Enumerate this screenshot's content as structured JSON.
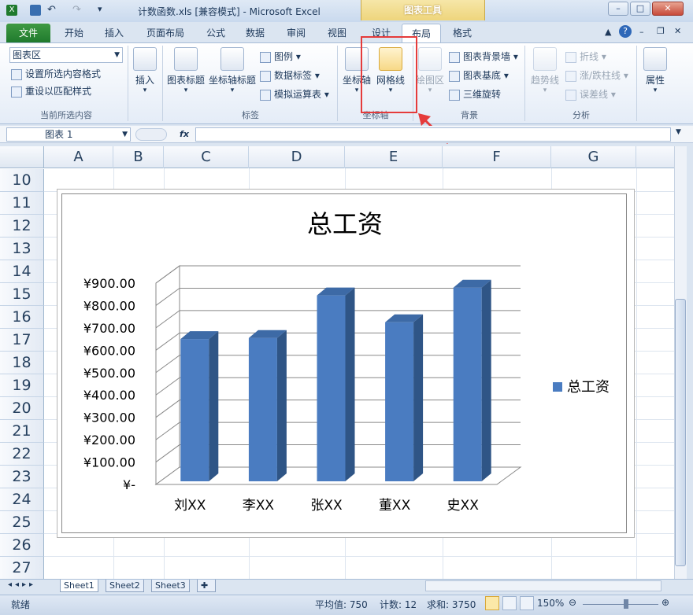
{
  "title_bar": {
    "title": "计数函数.xls  [兼容模式]  -  Microsoft Excel",
    "context_tool": "图表工具",
    "minimize": "–",
    "restore": "□",
    "close": "✕"
  },
  "tabs": [
    "文件",
    "开始",
    "插入",
    "页面布局",
    "公式",
    "数据",
    "审阅",
    "视图",
    "设计",
    "布局",
    "格式"
  ],
  "ribbon": {
    "selection_dropdown": "图表区",
    "format_selection": "设置所选内容格式",
    "reset_style": "重设以匹配样式",
    "group_current": "当前所选内容",
    "insert": "插入",
    "chart_title": "图表标题",
    "axis_title": "坐标轴标题",
    "legend": "图例",
    "data_labels": "数据标签",
    "data_table": "模拟运算表",
    "group_labels": "标签",
    "axes": "坐标轴",
    "gridlines": "网格线",
    "group_axes": "坐标轴",
    "plot_area": "绘图区",
    "chart_wall": "图表背景墙",
    "chart_floor": "图表基底",
    "rotation_3d": "三维旋转",
    "group_background": "背景",
    "trendline": "趋势线",
    "lines": "折线",
    "updown_bars": "涨/跌柱线",
    "error_bars": "误差线",
    "group_analysis": "分析",
    "properties": "属性"
  },
  "formula_bar": {
    "name_box": "图表 1",
    "fx": "fx",
    "value": ""
  },
  "columns": [
    "A",
    "B",
    "C",
    "D",
    "E",
    "F",
    "G"
  ],
  "rows": [
    "10",
    "11",
    "12",
    "13",
    "14",
    "15",
    "16",
    "17",
    "18",
    "19",
    "20",
    "21",
    "22",
    "23",
    "24",
    "25",
    "26",
    "27"
  ],
  "chart_data": {
    "type": "bar",
    "title": "总工资",
    "categories": [
      "刘XX",
      "李XX",
      "张XX",
      "董XX",
      "史XX"
    ],
    "series": [
      {
        "name": "总工资",
        "values": [
          650,
          655,
          845,
          725,
          880
        ]
      }
    ],
    "ylim": [
      0,
      900
    ],
    "yticks": [
      "¥-",
      "¥100.00",
      "¥200.00",
      "¥300.00",
      "¥400.00",
      "¥500.00",
      "¥600.00",
      "¥700.00",
      "¥800.00",
      "¥900.00"
    ],
    "grid": true,
    "legend": "right",
    "color": "#4a7cc1"
  },
  "sheets": [
    "Sheet1",
    "Sheet2",
    "Sheet3"
  ],
  "status": {
    "ready": "就绪",
    "average": "平均值: 750",
    "count": "计数: 12",
    "sum": "求和: 3750",
    "zoom": "150%"
  },
  "accent_colors": {
    "highlight_box": "#e53b3b",
    "file_tab": "#2e8b3a",
    "context_tab": "#eed57c"
  }
}
